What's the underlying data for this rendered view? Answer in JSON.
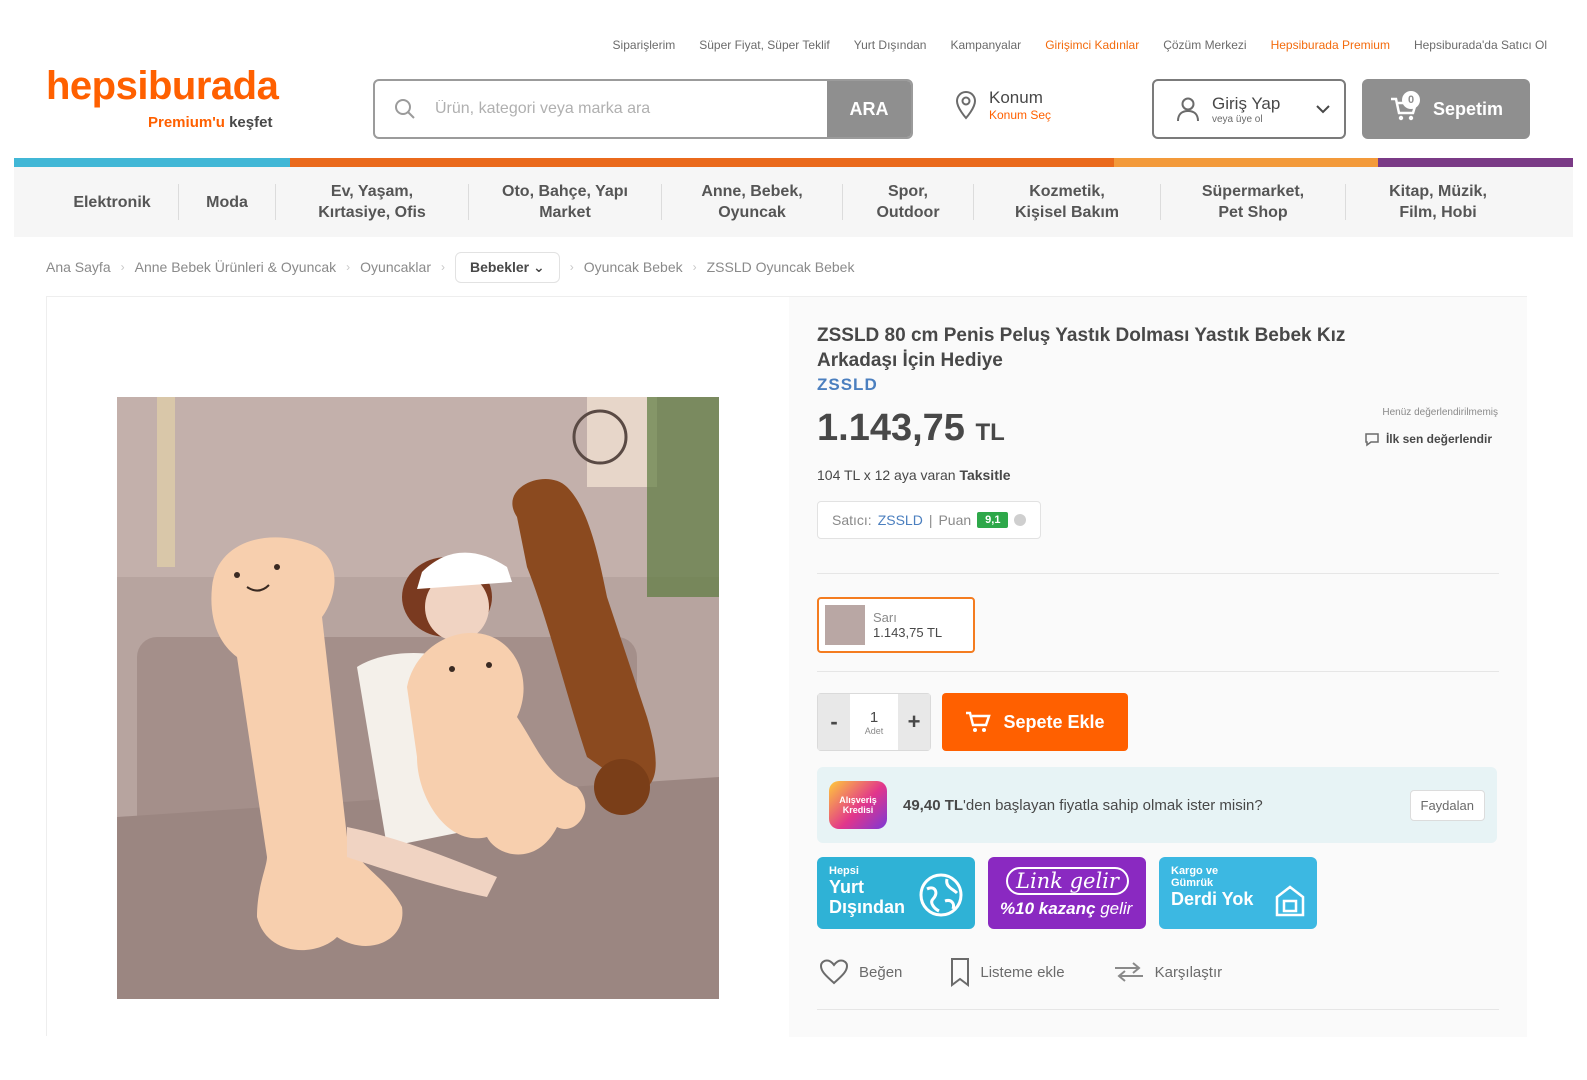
{
  "top_links": [
    {
      "label": "Siparişlerim",
      "highlight": false
    },
    {
      "label": "Süper Fiyat, Süper Teklif",
      "highlight": false
    },
    {
      "label": "Yurt Dışından",
      "highlight": false
    },
    {
      "label": "Kampanyalar",
      "highlight": false
    },
    {
      "label": "Girişimci Kadınlar",
      "highlight": true
    },
    {
      "label": "Çözüm Merkezi",
      "highlight": false
    },
    {
      "label": "Hepsiburada Premium",
      "highlight": true
    },
    {
      "label": "Hepsiburada'da Satıcı Ol",
      "highlight": false
    }
  ],
  "header": {
    "logo": "hepsiburada",
    "premium_a": "Premium'u",
    "premium_b": "keşfet",
    "search_placeholder": "Ürün, kategori veya marka ara",
    "search_button": "ARA",
    "location_title": "Konum",
    "location_sub": "Konum Seç",
    "login_title": "Giriş Yap",
    "login_sub": "veya üye ol",
    "cart_label": "Sepetim",
    "cart_count": "0"
  },
  "stripe_colors": [
    "#41b7d6",
    "#ea6a1c",
    "#f39a3a",
    "#7a3a86"
  ],
  "categories": [
    "Elektronik",
    "Moda",
    "Ev, Yaşam,\nKırtasiye, Ofis",
    "Oto, Bahçe, Yapı\nMarket",
    "Anne, Bebek,\nOyuncak",
    "Spor,\nOutdoor",
    "Kozmetik,\nKişisel Bakım",
    "Süpermarket,\nPet Shop",
    "Kitap, Müzik,\nFilm, Hobi"
  ],
  "breadcrumb": {
    "items": [
      "Ana Sayfa",
      "Anne Bebek Ürünleri & Oyuncak",
      "Oyuncaklar"
    ],
    "current_dropdown": "Bebekler",
    "tail": [
      "Oyuncak Bebek",
      "ZSSLD Oyuncak Bebek"
    ]
  },
  "product": {
    "title": "ZSSLD 80 cm Penis Peluş Yastık Dolması Yastık Bebek Kız Arkadaşı İçin Hediye",
    "brand": "ZSSLD",
    "price": "1.143,75",
    "currency": "TL",
    "installment_a": "104 TL x 12 aya varan",
    "installment_b": "Taksitle",
    "rating_none": "Henüz değerlendirilmemiş",
    "rating_first": "İlk sen değerlendir",
    "seller_prefix": "Satıcı:",
    "seller_name": "ZSSLD",
    "seller_score_label": "Puan",
    "seller_score": "9,1",
    "variant_name": "Sarı",
    "variant_price": "1.143,75 TL",
    "qty_minus": "-",
    "qty_value": "1",
    "qty_unit": "Adet",
    "qty_plus": "+",
    "add_to_cart": "Sepete Ekle",
    "promo_badge": "Alışveriş Kredisi",
    "promo_bold": "49,40 TL",
    "promo_text": "'den başlayan fiyatla sahip olmak ister misin?",
    "promo_button": "Faydalan",
    "tile_yurt_small": "Hepsi",
    "tile_yurt_big": "Yurt Dışından",
    "tile_link_script": "Link gelir",
    "tile_link_pct": "%10 kazanç",
    "tile_link_end": "gelir",
    "tile_kargo_small": "Kargo ve Gümrük",
    "tile_kargo_big": "Derdi Yok",
    "action_like": "Beğen",
    "action_list": "Listeme ekle",
    "action_compare": "Karşılaştır"
  }
}
